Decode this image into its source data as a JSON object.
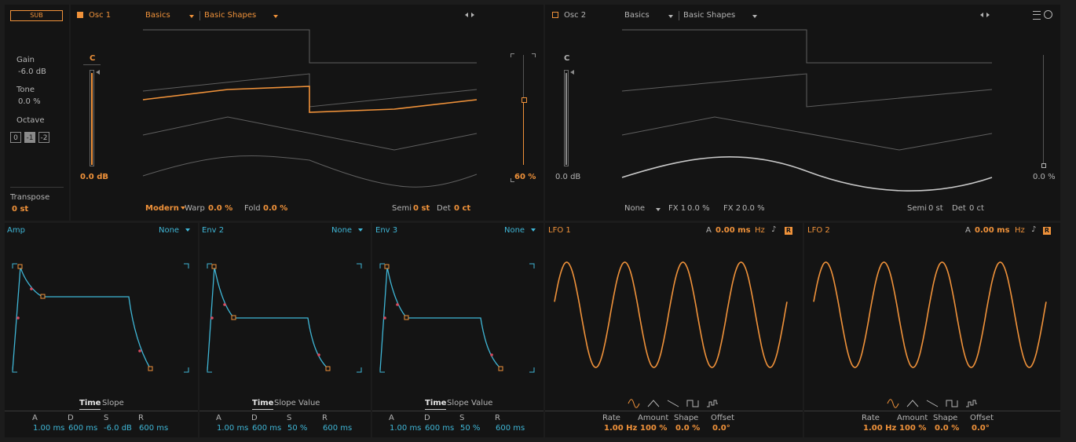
{
  "sub": {
    "label": "SUB",
    "gain_label": "Gain",
    "gain_value": "-6.0 dB",
    "tone_label": "Tone",
    "tone_value": "0.0 %",
    "octave_label": "Octave",
    "octave_options": [
      "0",
      "-1",
      "-2"
    ],
    "octave_selected": "-1",
    "transpose_label": "Transpose",
    "transpose_value": "0 st"
  },
  "osc1": {
    "title": "Osc 1",
    "enabled": true,
    "category": "Basics",
    "preset": "Basic Shapes",
    "note": "C",
    "level": "0.0 dB",
    "mix": "60 %",
    "mode": "Modern",
    "warp_label": "Warp",
    "warp_value": "0.0 %",
    "fold_label": "Fold",
    "fold_value": "0.0 %",
    "semi_label": "Semi",
    "semi_value": "0 st",
    "det_label": "Det",
    "det_value": "0 ct"
  },
  "osc2": {
    "title": "Osc 2",
    "enabled": false,
    "category": "Basics",
    "preset": "Basic Shapes",
    "note": "C",
    "level": "0.0 dB",
    "mix": "0.0 %",
    "mode": "None",
    "fx1_label": "FX 1",
    "fx1_value": "0.0 %",
    "fx2_label": "FX 2",
    "fx2_value": "0.0 %",
    "semi_label": "Semi",
    "semi_value": "0 st",
    "det_label": "Det",
    "det_value": "0 ct"
  },
  "envelopes": [
    {
      "title": "Amp",
      "target": "None",
      "tabs": [
        "Time",
        "Slope"
      ],
      "active_tab": "Time",
      "params": [
        {
          "label": "A",
          "value": "1.00 ms"
        },
        {
          "label": "D",
          "value": "600 ms"
        },
        {
          "label": "S",
          "value": "-6.0 dB"
        },
        {
          "label": "R",
          "value": "600 ms"
        }
      ]
    },
    {
      "title": "Env 2",
      "target": "None",
      "tabs": [
        "Time",
        "Slope",
        "Value"
      ],
      "active_tab": "Time",
      "params": [
        {
          "label": "A",
          "value": "1.00 ms"
        },
        {
          "label": "D",
          "value": "600 ms"
        },
        {
          "label": "S",
          "value": "50 %"
        },
        {
          "label": "R",
          "value": "600 ms"
        }
      ]
    },
    {
      "title": "Env 3",
      "target": "None",
      "tabs": [
        "Time",
        "Slope",
        "Value"
      ],
      "active_tab": "Time",
      "params": [
        {
          "label": "A",
          "value": "1.00 ms"
        },
        {
          "label": "D",
          "value": "600 ms"
        },
        {
          "label": "S",
          "value": "50 %"
        },
        {
          "label": "R",
          "value": "600 ms"
        }
      ]
    }
  ],
  "lfos": [
    {
      "title": "LFO 1",
      "attack_label": "A",
      "attack_value": "0.00 ms",
      "sync_label": "Hz",
      "retrig_label": "R",
      "params": [
        {
          "label": "Rate",
          "value": "1.00 Hz"
        },
        {
          "label": "Amount",
          "value": "100 %"
        },
        {
          "label": "Shape",
          "value": "0.0 %"
        },
        {
          "label": "Offset",
          "value": "0.0°"
        }
      ],
      "waveforms": [
        "sine",
        "triangle",
        "saw",
        "square",
        "random"
      ],
      "selected_waveform": "sine"
    },
    {
      "title": "LFO 2",
      "attack_label": "A",
      "attack_value": "0.00 ms",
      "sync_label": "Hz",
      "retrig_label": "R",
      "params": [
        {
          "label": "Rate",
          "value": "1.00 Hz"
        },
        {
          "label": "Amount",
          "value": "100 %"
        },
        {
          "label": "Shape",
          "value": "0.0 %"
        },
        {
          "label": "Offset",
          "value": "0.0°"
        }
      ],
      "waveforms": [
        "sine",
        "triangle",
        "saw",
        "square",
        "random"
      ],
      "selected_waveform": "sine"
    }
  ],
  "icons": {
    "nav_prev": "chevron-left-icon",
    "nav_next": "chevron-right-icon",
    "menu": "hamburger-menu-icon",
    "toggle": "circle-toggle-icon",
    "note": "note-icon"
  },
  "colors": {
    "accent_orange": "#f0923a",
    "accent_blue": "#3fb6d6",
    "panel_bg": "#141414",
    "frame_bg": "#1c1c1c"
  }
}
